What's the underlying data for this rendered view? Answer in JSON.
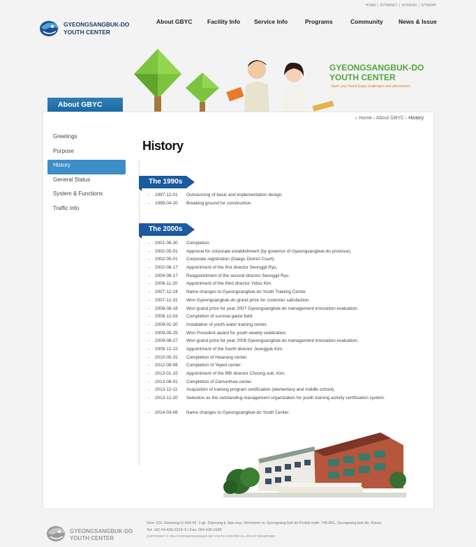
{
  "utility_links": [
    "HOME",
    "INTRANET",
    "KOREAN",
    "SITEMAP"
  ],
  "logo": {
    "line1": "GYEONGSANGBUK-DO",
    "line2": "YOUTH CENTER"
  },
  "gnb": [
    "About GBYC",
    "Facility Info",
    "Service Info",
    "Programs",
    "Community",
    "News & Issue"
  ],
  "visual": {
    "title1": "GYEONGSANGBUK-DO",
    "title2": "YOUTH CENTER",
    "slogan": "Open your heart! Enjoy challenges and adventures!"
  },
  "sub_tab": "About GBYC",
  "snb": [
    {
      "label": "Greetings",
      "active": false
    },
    {
      "label": "Purpose",
      "active": false
    },
    {
      "label": "History",
      "active": true
    },
    {
      "label": "General Status",
      "active": false
    },
    {
      "label": "System & Functions",
      "active": false
    },
    {
      "label": "Traffic Info",
      "active": false
    }
  ],
  "breadcrumb": {
    "home": "Home",
    "level1": "About GBYC",
    "current": "History"
  },
  "page_title": "History",
  "sections": [
    {
      "title": "The 1990s",
      "items": [
        {
          "date": "1997-12-01",
          "text": "Outsourcing of basic and implementation design."
        },
        {
          "date": "1999-04-20",
          "text": "Breaking ground for construction."
        }
      ]
    },
    {
      "title": "The 2000s",
      "items": [
        {
          "date": "2001-08-30",
          "text": "Completion."
        },
        {
          "date": "2002-05-01",
          "text": "Approval for corporate establishment (by governor of Gyeongsangbuk-do province)."
        },
        {
          "date": "2002-05-01",
          "text": "Corporate registration (Daegu District Court)."
        },
        {
          "date": "2002-08-17",
          "text": "Appointment of the first director Seonggil Ryu."
        },
        {
          "date": "2004-08-17",
          "text": "Reappointment of the second director Seonggil Ryu."
        },
        {
          "date": "2006-11-20",
          "text": "Appointment of the third director Yidoo Kim."
        },
        {
          "date": "2007-12-24",
          "text": "Name changes to Gyeongsangbuk-do Youth Training Center"
        },
        {
          "date": "2007-12-31",
          "text": "Won Gyeongsangbuk-do grand prize for customer satisfaction."
        },
        {
          "date": "2008-08-18",
          "text": "Won grand prize for year 2007 Gyeongsangbuk-do management innovation evaluation."
        },
        {
          "date": "2008-12-03",
          "text": "Completion of survival game field."
        },
        {
          "date": "2009-01-20",
          "text": "Installation of youth water training center."
        },
        {
          "date": "2009-05-25",
          "text": "Won President award for youth weekly celebration."
        },
        {
          "date": "2009-08-27",
          "text": "Won grand prize for year 2008 Gyeongsangbuk-do management innovation evaluation."
        },
        {
          "date": "2009-12-22",
          "text": "Appointment of the fourth director Jeongguk Kim."
        },
        {
          "date": "2010-05-31",
          "text": "Completion of Hwarang center."
        },
        {
          "date": "2012-08-08",
          "text": "Completion of Yejeol center."
        },
        {
          "date": "2013-01-15",
          "text": "Appointment of the fifth director Choong-sub. Kim."
        },
        {
          "date": "2013-08-01",
          "text": "Completion of Damunhwa center."
        },
        {
          "date": "2013-12-11",
          "text": "Acquisition of training program certification (elementary and middle school)."
        },
        {
          "date": "2013-12-20",
          "text": "Selection as the outstanding management organization for youth training activity certification system."
        },
        {
          "date": "2014-03-06",
          "text": "Name changes to Gyeongsangbuk-do Youth Center."
        }
      ]
    }
  ],
  "footer": {
    "logo_line1": "GYEONGSANGBUK-DO",
    "logo_line2": "YOUTH CENTER",
    "address": "(Son 120, Daesung-ri) 594-43, 1-gil, Daesung-ji, Apo-eup, Kimcheon-si, Gyungsang buk-do Postal code: 740-861, Gyungsang buk-do, Korea",
    "phone": "Tel: +82-54-436-0154~5 / Fax: 054-436-0189",
    "copyright": "COPYRIGHT © 2014  GYEONGSANGBUK-DO YOUTH CENTER  ALL RIGHT RESERVED"
  }
}
